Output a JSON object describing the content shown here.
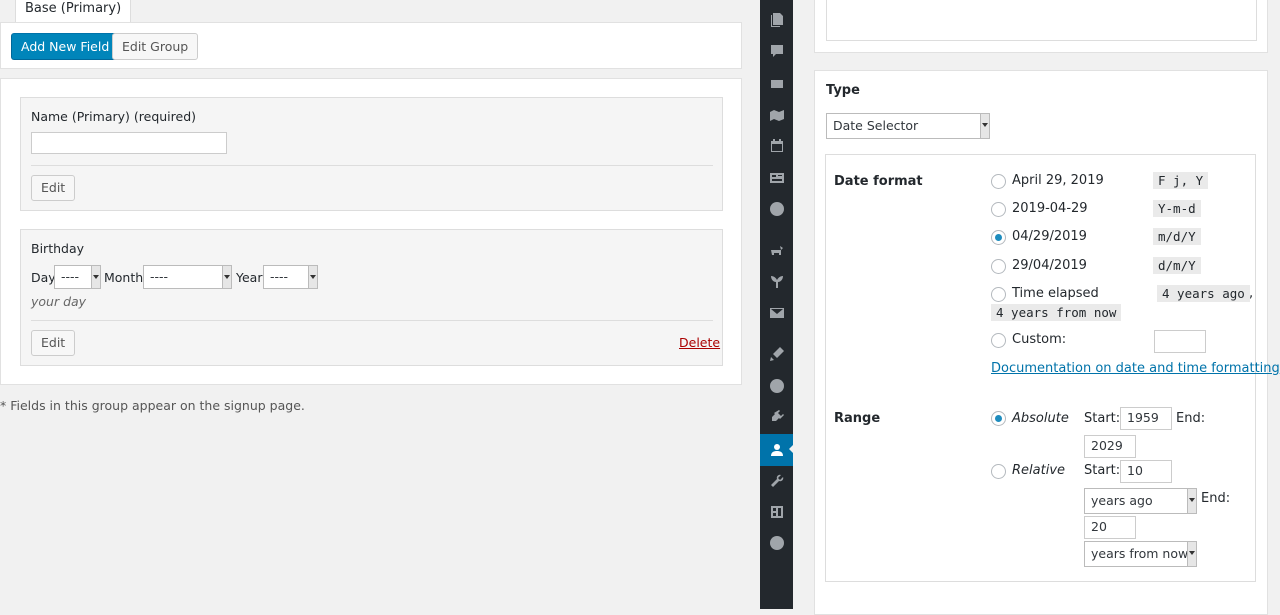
{
  "tabs": {
    "active_label": "Base (Primary)"
  },
  "toolbar": {
    "add_field_label": "Add New Field",
    "edit_group_label": "Edit Group"
  },
  "fields": {
    "name": {
      "label": "Name (Primary) (required)",
      "value": "",
      "edit_label": "Edit"
    },
    "birthday": {
      "label": "Birthday",
      "day_label": "Day",
      "day_value": "----",
      "month_label": "Month",
      "month_value": "----",
      "year_label": "Year",
      "year_value": "----",
      "description": "your day",
      "edit_label": "Edit",
      "delete_label": "Delete"
    }
  },
  "footnote": "* Fields in this group appear on the signup page.",
  "admin_menu": {
    "icons": [
      "pages-icon",
      "comments-icon",
      "feedback-icon",
      "map-icon",
      "calendar-icon",
      "forms-icon",
      "globe-icon",
      "pets-icon",
      "plant-icon",
      "mail-icon",
      "appearance-icon",
      "buddypress-icon",
      "plugins-icon",
      "users-icon",
      "tools-icon",
      "settings-icon",
      "media-play-icon"
    ],
    "active": "users-icon"
  },
  "settings": {
    "type_label": "Type",
    "type_value": "Date Selector",
    "date_format": {
      "label": "Date format",
      "options": [
        {
          "label": "April 29, 2019",
          "code": "F j, Y",
          "checked": false
        },
        {
          "label": "2019-04-29",
          "code": "Y-m-d",
          "checked": false
        },
        {
          "label": "04/29/2019",
          "code": "m/d/Y",
          "checked": true
        },
        {
          "label": "29/04/2019",
          "code": "d/m/Y",
          "checked": false
        }
      ],
      "elapsed_label": "Time elapsed",
      "elapsed_code_1": "4 years ago",
      "elapsed_sep": ",",
      "elapsed_code_2": "4 years from now",
      "custom_label": "Custom:",
      "custom_value": "",
      "doc_link": "Documentation on date and time formatting"
    },
    "range": {
      "label": "Range",
      "absolute_label": "Absolute",
      "absolute_checked": true,
      "start_label": "Start:",
      "end_label": "End:",
      "absolute_start": "1959",
      "absolute_end": "2029",
      "relative_label": "Relative",
      "relative_checked": false,
      "relative_start": "10",
      "relative_start_unit": "years ago",
      "relative_end": "20",
      "relative_end_unit": "years from now"
    }
  }
}
